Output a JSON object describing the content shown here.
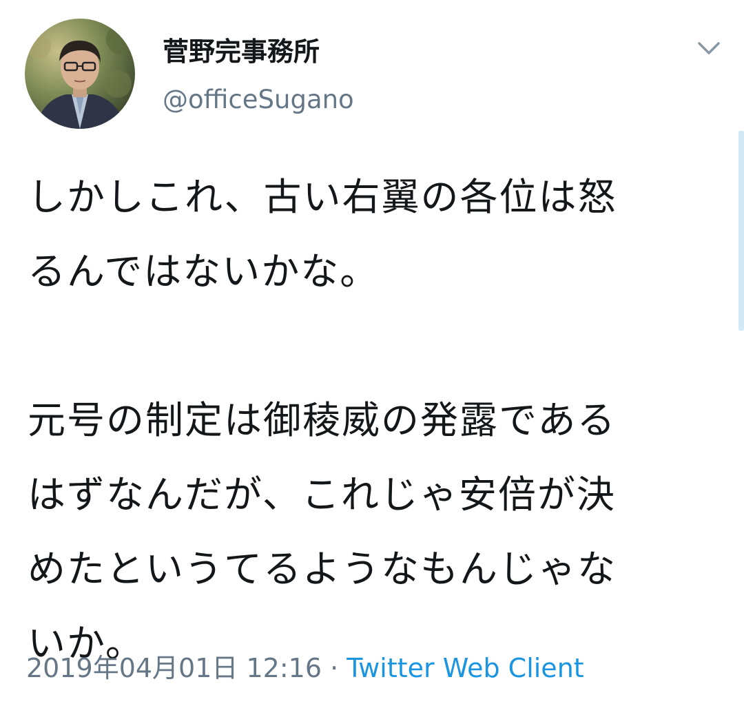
{
  "tweet": {
    "display_name": "菅野完事務所",
    "handle": "@officeSugano",
    "paragraphs": [
      "しかしこれ、古い右翼の各位は怒\nるんではないかな。",
      "元号の制定は御稜威の発露である\nはずなんだが、これじゃ安倍が決\nめたというてるようなもんじゃな\nいか。"
    ],
    "timestamp": "2019年04月01日 12:16",
    "separator": "·",
    "client": "Twitter Web Client"
  },
  "colors": {
    "text": "#14171a",
    "secondary": "#657786",
    "link": "#1b95e0",
    "scrollbar": "#d4e9f7"
  },
  "icons": {
    "menu": "chevron-down-icon"
  }
}
